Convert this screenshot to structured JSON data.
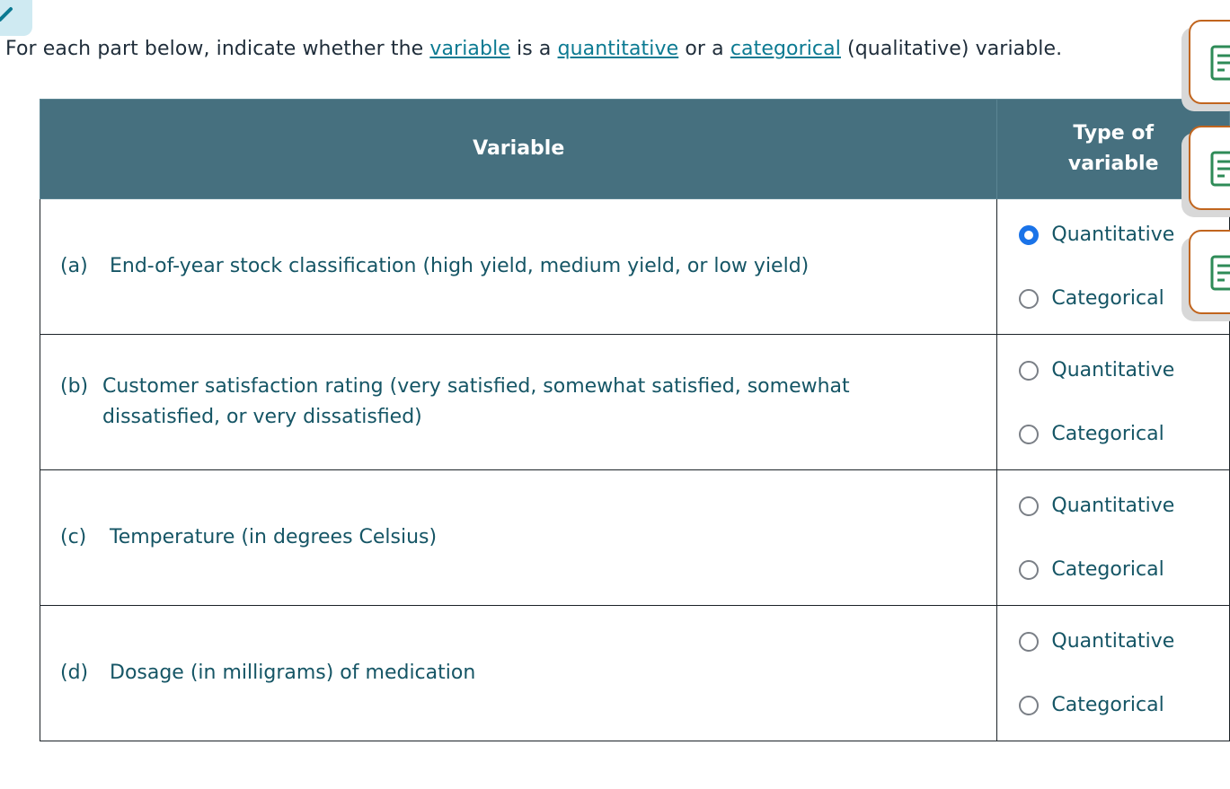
{
  "instructions": {
    "prefix": "For each part below, indicate whether the ",
    "link_variable": "variable",
    "mid1": " is a ",
    "link_quantitative": "quantitative",
    "mid2": " or a ",
    "link_categorical": "categorical",
    "suffix": " (qualitative) variable."
  },
  "table": {
    "header_variable": "Variable",
    "header_type": "Type of variable",
    "rows": [
      {
        "letter": "(a)",
        "text": "End-of-year stock classification (high yield, medium yield, or low yield)",
        "option_quantitative": "Quantitative",
        "option_categorical": "Categorical",
        "selected": "Quantitative"
      },
      {
        "letter": "(b)",
        "text": "Customer satisfaction rating (very satisfied, somewhat satisfied, somewhat dissatisfied, or very dissatisfied)",
        "option_quantitative": "Quantitative",
        "option_categorical": "Categorical",
        "selected": ""
      },
      {
        "letter": "(c)",
        "text": "Temperature (in degrees Celsius)",
        "option_quantitative": "Quantitative",
        "option_categorical": "Categorical",
        "selected": ""
      },
      {
        "letter": "(d)",
        "text": "Dosage (in milligrams) of medication",
        "option_quantitative": "Quantitative",
        "option_categorical": "Categorical",
        "selected": ""
      }
    ]
  },
  "side_tools": [
    "calculator-icon",
    "calculator-icon",
    "calculator-icon"
  ],
  "colors": {
    "header_bg": "#46707f",
    "link": "#0b7a92",
    "radio_selected": "#1a73e8",
    "tool_border": "#c1651e",
    "tool_icon": "#2e8b57"
  }
}
